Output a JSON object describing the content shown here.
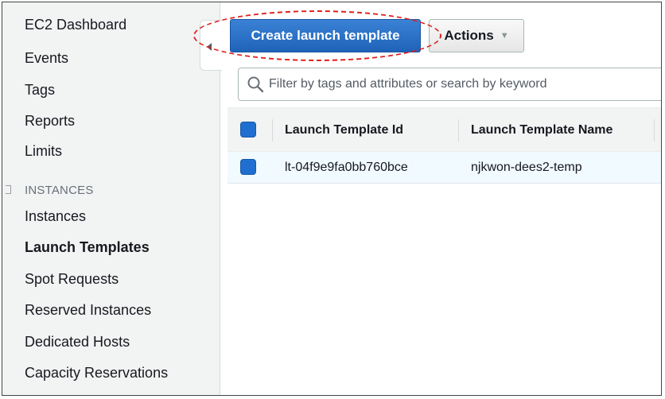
{
  "sidebar": {
    "items": [
      {
        "label": "EC2 Dashboard"
      },
      {
        "label": "Events"
      },
      {
        "label": "Tags"
      },
      {
        "label": "Reports"
      },
      {
        "label": "Limits"
      }
    ],
    "section_header": "INSTANCES",
    "section_items": [
      {
        "label": "Instances"
      },
      {
        "label": "Launch Templates",
        "active": true
      },
      {
        "label": "Spot Requests"
      },
      {
        "label": "Reserved Instances"
      },
      {
        "label": "Dedicated Hosts"
      },
      {
        "label": "Capacity Reservations"
      }
    ]
  },
  "toolbar": {
    "create_label": "Create launch template",
    "actions_label": "Actions",
    "actions_caret": "▼"
  },
  "search": {
    "placeholder": "Filter by tags and attributes or search by keyword"
  },
  "table": {
    "columns": [
      "Launch Template Id",
      "Launch Template Name"
    ],
    "rows": [
      {
        "id": "lt-04f9e9fa0bb760bce",
        "name": "njkwon-dees2-temp",
        "selected": true
      }
    ]
  },
  "colors": {
    "primary_button": "#1f63b8",
    "highlight": "#e02020",
    "checkbox": "#1f6fd1",
    "sidebar_bg": "#f2f3f3"
  }
}
